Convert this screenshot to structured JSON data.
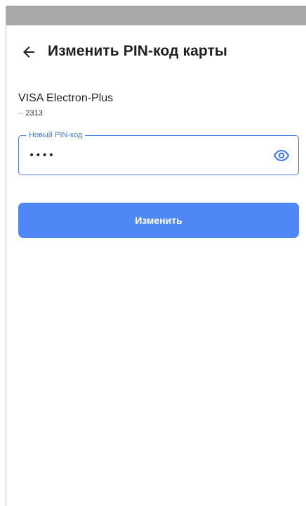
{
  "header": {
    "back_icon": "arrow-left-icon",
    "title": "Изменить PIN-код карты"
  },
  "card": {
    "name": "VISA Electron-Plus",
    "number": "·· 2313"
  },
  "pin_field": {
    "label": "Новый PIN-код",
    "value": "••••",
    "visibility_icon": "eye-icon",
    "accent_color": "#4a7fe8"
  },
  "submit": {
    "label": "Изменить",
    "color": "#4f87f7"
  }
}
